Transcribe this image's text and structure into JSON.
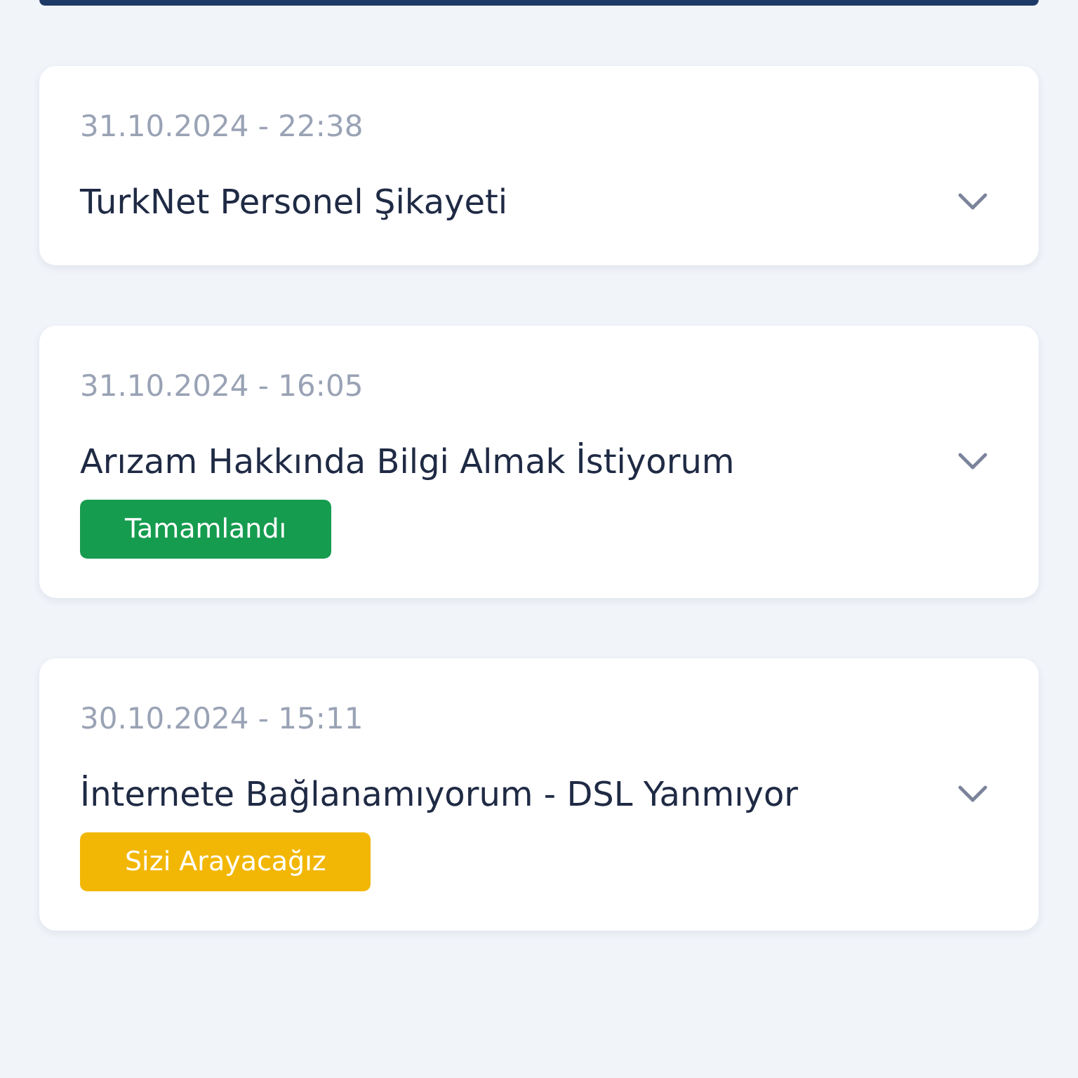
{
  "requests": [
    {
      "date": "31.10.2024 - 22:38",
      "title": "TurkNet Personel Şikayeti",
      "expanded": false
    },
    {
      "date": "31.10.2024 - 16:05",
      "title": "Arızam Hakkında Bilgi Almak İstiyorum",
      "expanded": false,
      "status": {
        "kind": "completed",
        "label": "Tamamlandı"
      }
    },
    {
      "date": "30.10.2024 - 15:11",
      "title": "İnternete Bağlanamıyorum - DSL Yanmıyor",
      "expanded": false,
      "status": {
        "kind": "pending",
        "label": "Sizi Arayacağız"
      }
    }
  ]
}
